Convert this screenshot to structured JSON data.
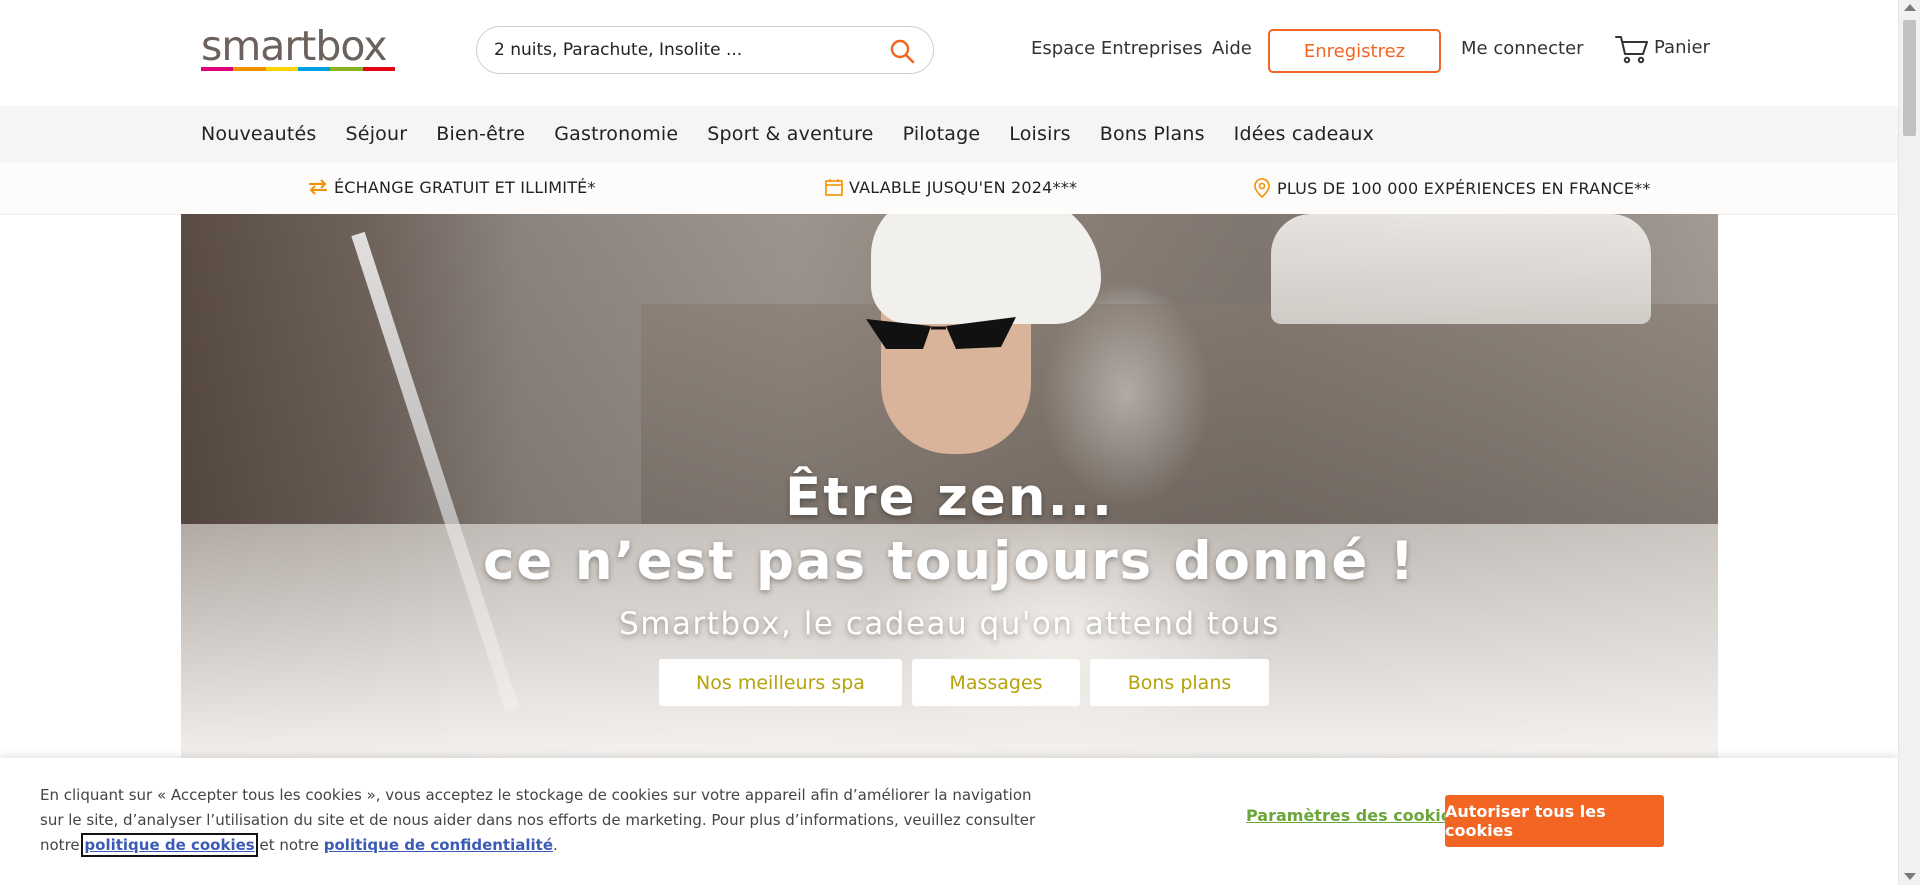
{
  "header": {
    "logo_text": "smartbox",
    "logo_colors": [
      "#e2007a",
      "#f39200",
      "#ffd200",
      "#00a0e3",
      "#8bb31d",
      "#e30613"
    ],
    "search_placeholder": "2 nuits, Parachute, Insolite ...",
    "search_icon": "search-icon",
    "links": {
      "business": "Espace Entreprises",
      "help": "Aide",
      "register": "Enregistrez",
      "login": "Me connecter",
      "cart": "Panier"
    },
    "accent_color": "#f26522"
  },
  "nav": {
    "items": [
      "Nouveautés",
      "Séjour",
      "Bien-être",
      "Gastronomie",
      "Sport & aventure",
      "Pilotage",
      "Loisirs",
      "Bons Plans",
      "Idées cadeaux"
    ]
  },
  "usp": {
    "exchange": "ÉCHANGE GRATUIT ET ILLIMITÉ*",
    "valid": "VALABLE JUSQU'EN 2024***",
    "experiences": "PLUS DE 100 000 EXPÉRIENCES EN FRANCE**"
  },
  "hero": {
    "title_line1": "Être zen...",
    "title_line2": "ce n’est pas toujours donné !",
    "subtitle": "Smartbox, le cadeau qu'on attend tous",
    "buttons": [
      "Nos meilleurs spa",
      "Massages",
      "Bons plans"
    ]
  },
  "cookie": {
    "text_before": "En cliquant sur « Accepter tous les cookies », vous acceptez le stockage de cookies sur votre appareil afin d’améliorer la navigation sur le site, d’analyser l’utilisation du site et de nous aider dans nos efforts de marketing. Pour plus d’informations, veuillez consulter notre ",
    "cookie_policy": "politique de cookies",
    "text_middle": " et notre ",
    "privacy_policy": "politique de confidentialité",
    "text_after": ".",
    "settings": "Paramètres des cookies",
    "accept": "Autoriser tous les cookies"
  }
}
